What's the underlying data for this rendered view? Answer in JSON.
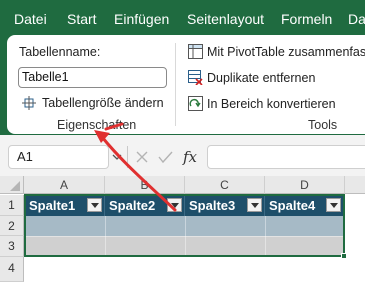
{
  "menu": {
    "items": [
      "Datei",
      "Start",
      "Einfügen",
      "Seitenlayout",
      "Formeln",
      "Da"
    ]
  },
  "ribbon": {
    "table_name_label": "Tabellenname:",
    "table_name_value": "Tabelle1",
    "resize_label": "Tabellengröße ändern",
    "properties_group_label": "Eigenschaften",
    "pivot_label": "Mit PivotTable zusammenfasse",
    "remove_duplicates_label": "Duplikate entfernen",
    "convert_range_label": "In Bereich konvertieren",
    "tools_group_label": "Tools"
  },
  "formula_bar": {
    "cell_ref": "A1",
    "fx_label": "fx"
  },
  "sheet": {
    "columns": [
      "A",
      "B",
      "C",
      "D"
    ],
    "rows": [
      "1",
      "2",
      "3",
      "4"
    ],
    "table_headers": [
      "Spalte1",
      "Spalte2",
      "Spalte3",
      "Spalte4"
    ]
  },
  "colors": {
    "title_bar": "#1f6b40",
    "table_header": "#1e4f6a",
    "table_row_band_1": "#a6bac6",
    "table_row_band_2": "#d0d0d0",
    "annotation_arrow": "#e03030"
  }
}
